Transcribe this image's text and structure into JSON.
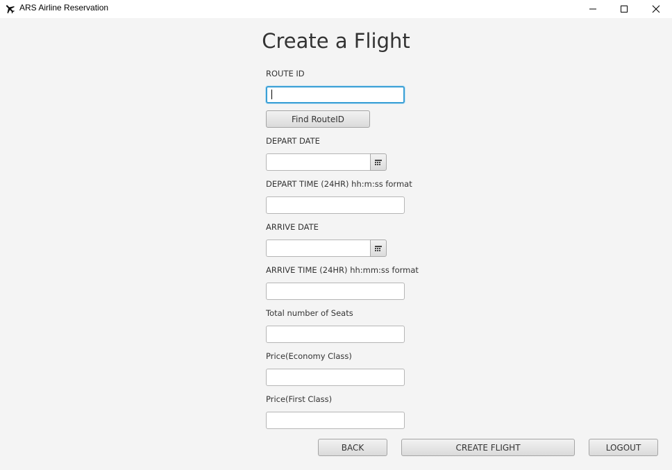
{
  "window": {
    "title": "ARS Airline Reservation",
    "app_icon": "airplane-icon",
    "controls": [
      "minimize-icon",
      "maximize-icon",
      "close-icon"
    ]
  },
  "page": {
    "heading": "Create a Flight"
  },
  "form": {
    "route_id": {
      "label": "ROUTE ID",
      "value": "",
      "focused": true
    },
    "find_route_button": "Find RouteID",
    "depart_date": {
      "label": "DEPART DATE",
      "value": "",
      "picker_icon": "calendar-icon"
    },
    "depart_time": {
      "label": "DEPART TIME (24HR) hh:m:ss format",
      "value": ""
    },
    "arrive_date": {
      "label": "ARRIVE DATE",
      "value": "",
      "picker_icon": "calendar-icon"
    },
    "arrive_time": {
      "label": "ARRIVE TIME (24HR) hh:mm:ss format",
      "value": ""
    },
    "total_seats": {
      "label": "Total number of Seats",
      "value": ""
    },
    "price_economy": {
      "label": "Price(Economy Class)",
      "value": ""
    },
    "price_first": {
      "label": "Price(First Class)",
      "value": ""
    }
  },
  "actions": {
    "back": "BACK",
    "create_flight": "CREATE FLIGHT",
    "logout": "LOGOUT"
  },
  "colors": {
    "background": "#f4f4f4",
    "focus_border": "#3a9fd5"
  }
}
